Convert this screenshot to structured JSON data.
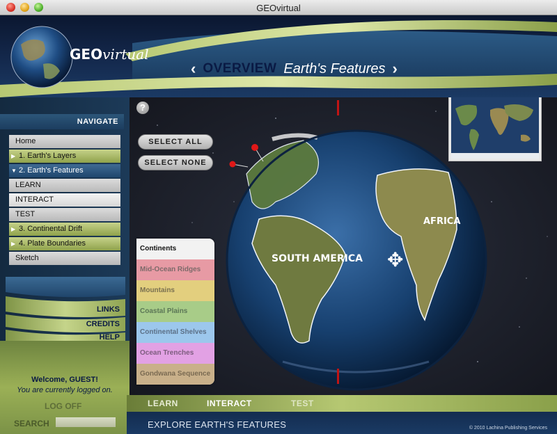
{
  "window": {
    "title": "GEOvirtual"
  },
  "header": {
    "logo_geo": "GEO",
    "logo_virtual": "virtual",
    "overview_label": "OVERVIEW",
    "subtitle": "Earth's Features",
    "prev_symbol": "‹",
    "next_symbol": "›"
  },
  "sidebar": {
    "navigate_label": "NAVIGATE",
    "items": [
      {
        "label": "Home",
        "style": "grey",
        "arrow": ""
      },
      {
        "label": "1. Earth's Layers",
        "style": "green",
        "arrow": "▶"
      },
      {
        "label": "2. Earth's Features",
        "style": "blue",
        "arrow": "▼"
      },
      {
        "label": "LEARN",
        "style": "grey",
        "arrow": ""
      },
      {
        "label": "INTERACT",
        "style": "white",
        "arrow": ""
      },
      {
        "label": "TEST",
        "style": "grey",
        "arrow": ""
      },
      {
        "label": "3. Continental Drift",
        "style": "green",
        "arrow": "▶"
      },
      {
        "label": "4. Plate Boundaries",
        "style": "green",
        "arrow": "▶"
      },
      {
        "label": "Sketch",
        "style": "grey",
        "arrow": ""
      }
    ],
    "links_label": "LINKS",
    "credits_label": "CREDITS",
    "help_label": "HELP",
    "welcome": "Welcome, GUEST!",
    "logged_on": "You are currently logged on.",
    "logoff_label": "LOG OFF",
    "search_label": "SEARCH",
    "search_value": ""
  },
  "main": {
    "help_symbol": "?",
    "select_all": "SELECT ALL",
    "select_none": "SELECT NONE",
    "layers": [
      {
        "label": "Continents",
        "color": "#f2f2f2",
        "text_color": "#111111"
      },
      {
        "label": "Mid-Ocean Ridges",
        "color": "#e79aa4",
        "text_color": "#7d6a6a"
      },
      {
        "label": "Mountains",
        "color": "#e3cf7e",
        "text_color": "#7a7050"
      },
      {
        "label": "Coastal Plains",
        "color": "#a8cc88",
        "text_color": "#5b7656"
      },
      {
        "label": "Continental Shelves",
        "color": "#9cc7ec",
        "text_color": "#5b6f86"
      },
      {
        "label": "Ocean Trenches",
        "color": "#e2a1e4",
        "text_color": "#7c5c7e"
      },
      {
        "label": "Gondwana Sequence",
        "color": "#c9b08a",
        "text_color": "#7a6a52"
      }
    ],
    "globe_labels": {
      "south_america": "SOUTH AMERICA",
      "africa": "AFRICA"
    },
    "move_symbol": "✥"
  },
  "bottom": {
    "tabs": [
      {
        "label": "LEARN",
        "active": false
      },
      {
        "label": "INTERACT",
        "active": true
      },
      {
        "label": "TEST",
        "active": false
      }
    ],
    "explore": "EXPLORE EARTH'S FEATURES",
    "copyright": "© 2010 Lachina Publishing Services"
  }
}
